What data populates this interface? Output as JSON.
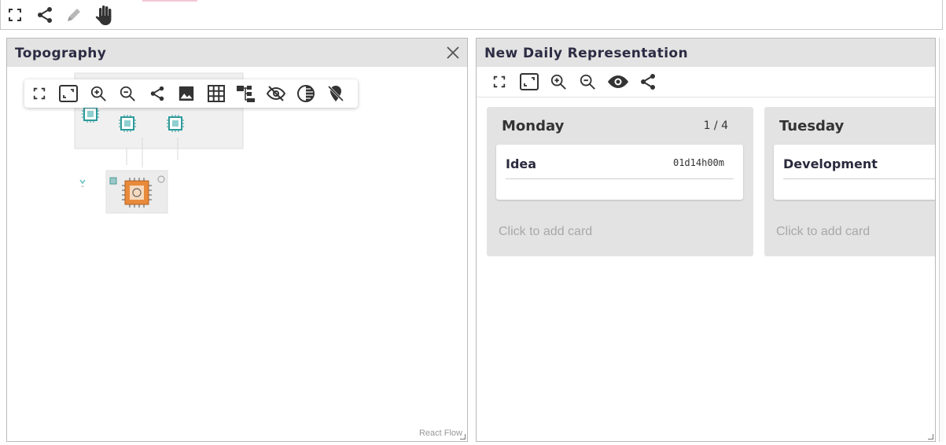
{
  "top_toolbar": {
    "icons": [
      "fullscreen-icon",
      "share-icon",
      "pencil-icon",
      "hand-icon"
    ]
  },
  "topography": {
    "title": "Topography",
    "toolbar_icons": [
      "fullscreen-icon",
      "fit-view-icon",
      "zoom-in-icon",
      "zoom-out-icon",
      "share-icon",
      "image-icon",
      "grid-icon",
      "layout-tree-icon",
      "hide-icon",
      "contrast-icon",
      "location-off-icon"
    ],
    "attribution": "React Flow"
  },
  "daily": {
    "title": "New Daily Representation",
    "toolbar_icons": [
      "fullscreen-icon",
      "fit-view-icon",
      "zoom-in-icon",
      "zoom-out-icon",
      "eye-icon",
      "share-icon"
    ],
    "lanes": [
      {
        "title": "Monday",
        "count": "1 / 4",
        "cards": [
          {
            "title": "Idea",
            "meta": "01d14h00m"
          }
        ],
        "add_label": "Click to add card"
      },
      {
        "title": "Tuesday",
        "count": "",
        "cards": [
          {
            "title": "Development",
            "meta": ""
          }
        ],
        "add_label": "Click to add card"
      }
    ]
  },
  "colors": {
    "header_bg": "#e3e3e3",
    "chip_teal": "#2e9a9a",
    "chip_orange": "#e88a3a"
  }
}
